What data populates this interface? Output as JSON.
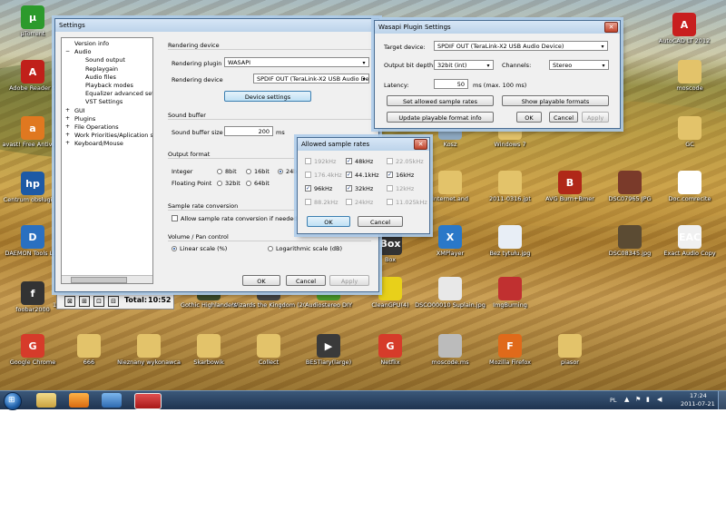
{
  "desktop_icons": [
    {
      "label": "µTorrent",
      "glyph": "µ",
      "color": "#2c9a2c"
    },
    {
      "label": "Adobe Reader 9",
      "glyph": "A",
      "color": "#c0201a"
    },
    {
      "label": "avast! Free Antivirus",
      "glyph": "a",
      "color": "#e07820"
    },
    {
      "label": "Centrum obsługi HP",
      "glyph": "hp",
      "color": "#1d5aa5"
    },
    {
      "label": "DAEMON Tools Lite",
      "glyph": "D",
      "color": "#2a70c0"
    },
    {
      "label": "foobar2000",
      "glyph": "f",
      "color": "#333333"
    },
    {
      "label": "Google Chrome",
      "glyph": "G",
      "color": "#d63b2a"
    },
    {
      "label": "666",
      "glyph": "",
      "color": "#e3c36a"
    },
    {
      "label": "Nieznany wykonawca",
      "glyph": "",
      "color": "#e3c36a"
    },
    {
      "label": "Skarbowik",
      "glyph": "",
      "color": "#e3c36a"
    },
    {
      "label": "Collect",
      "glyph": "",
      "color": "#e3c36a"
    },
    {
      "label": "BESTiary(large)",
      "glyph": "▶",
      "color": "#3a3a3a"
    },
    {
      "label": "Netflix",
      "glyph": "G",
      "color": "#d63b2a"
    },
    {
      "label": "moscode.ms",
      "glyph": "",
      "color": "#bbbbbb"
    },
    {
      "label": "Mozilla Firefox",
      "glyph": "F",
      "color": "#e06a1a"
    },
    {
      "label": "piasor",
      "glyph": "",
      "color": "#e3c36a"
    },
    {
      "label": "AutoCAD LT 2012",
      "glyph": "A",
      "color": "#c81f1f"
    },
    {
      "label": "moscode",
      "glyph": "",
      "color": "#e3c36a"
    },
    {
      "label": "GC",
      "glyph": "",
      "color": "#e3c36a"
    },
    {
      "label": "Kosz",
      "glyph": "",
      "color": "#8ea9c2"
    },
    {
      "label": "Windows 7",
      "glyph": "",
      "color": "#e3c36a"
    },
    {
      "label": "Internet.and",
      "glyph": "",
      "color": "#e3c36a"
    },
    {
      "label": "2011-0316.jpt",
      "glyph": "",
      "color": "#e3c36a"
    },
    {
      "label": "AVG Burn+Bmer",
      "glyph": "B",
      "color": "#b02818"
    },
    {
      "label": "DSC07965.JPG",
      "glyph": "",
      "color": "#7a3a2a"
    },
    {
      "label": "Doc.comrecite",
      "glyph": "",
      "color": "#ffffff"
    },
    {
      "label": "XMPlayer",
      "glyph": "X",
      "color": "#2a78c8"
    },
    {
      "label": "Bez tytułu.jpg",
      "glyph": "",
      "color": "#e8eef6"
    },
    {
      "label": "DSC08345.jpg",
      "glyph": "",
      "color": "#5b4b33"
    },
    {
      "label": "Exact Audio Copy",
      "glyph": "EAC",
      "color": "#f0f0f0"
    },
    {
      "label": "CleanGPU(4)",
      "glyph": "",
      "color": "#e8d01a"
    },
    {
      "label": "DSCO00010 Suplain.jpg",
      "glyph": "",
      "color": "#e8e8e8"
    },
    {
      "label": "ImgBurning",
      "glyph": "",
      "color": "#c03030"
    },
    {
      "label": "Box",
      "glyph": "Box",
      "color": "#333333"
    },
    {
      "label": "Wizards the Kingdom (2002)",
      "glyph": "",
      "color": "#444444"
    },
    {
      "label": "Audiostereo DIY",
      "glyph": "",
      "color": "#4a9a2a"
    },
    {
      "label": "Gothic Highlanders",
      "glyph": "",
      "color": "#3a4a2a"
    },
    {
      "label": "muzyka",
      "glyph": "",
      "color": "#e3c36a"
    },
    {
      "label": "13. The Final Frontier (2010)",
      "glyph": "",
      "color": "#222222"
    }
  ],
  "foobar_strip": {
    "total_label": "Total:",
    "total_value": "10:52"
  },
  "settings_window": {
    "title": "Settings",
    "tree": [
      {
        "label": "Version info",
        "indent": 0
      },
      {
        "label": "Audio",
        "indent": 0
      },
      {
        "label": "Sound output",
        "indent": 1
      },
      {
        "label": "Replaygain",
        "indent": 1
      },
      {
        "label": "Audio files",
        "indent": 1
      },
      {
        "label": "Playback modes",
        "indent": 1
      },
      {
        "label": "Equalizer advanced settings",
        "indent": 1
      },
      {
        "label": "VST Settings",
        "indent": 1
      },
      {
        "label": "GUI",
        "indent": 0
      },
      {
        "label": "Plugins",
        "indent": 0
      },
      {
        "label": "File Operations",
        "indent": 0
      },
      {
        "label": "Work Priorities/Aplication settings",
        "indent": 0
      },
      {
        "label": "Keyboard/Mouse",
        "indent": 0
      }
    ],
    "rendering_device_header": "Rendering device",
    "rendering_plugin_label": "Rendering plugin",
    "rendering_plugin_value": "WASAPI",
    "rendering_device_label": "Rendering device",
    "rendering_device_value": "SPDIF OUT (TeraLink-X2 USB Audio Device)",
    "device_settings_label": "Device settings",
    "sound_buffer_header": "Sound buffer",
    "sound_buffer_label": "Sound buffer size",
    "sound_buffer_value": "200",
    "sound_buffer_unit": "ms",
    "output_format_header": "Output format",
    "integer_label": "Integer",
    "integer_8bit": "8bit",
    "integer_16bit": "16bit",
    "integer_24bit": "24bit",
    "floating_label": "Floating Point",
    "float_32bit": "32bit",
    "float_64bit": "64bit",
    "src_header": "Sample rate conversion",
    "src_checkbox_label": "Allow sample rate conversion if needed",
    "volume_header": "Volume / Pan control",
    "linear_label": "Linear scale (%)",
    "log_label": "Logarithmic scale (dB)",
    "ok": "OK",
    "cancel": "Cancel",
    "apply": "Apply"
  },
  "wasapi_window": {
    "title": "Wasapi Plugin Settings",
    "target_label": "Target device:",
    "target_value": "SPDIF OUT (TeraLink-X2 USB Audio Device)",
    "depth_label": "Output bit depth:",
    "depth_value": "32bit (int)",
    "channels_label": "Channels:",
    "channels_value": "Stereo",
    "latency_label": "Latency:",
    "latency_value": "50",
    "latency_unit": "ms  (max. 100 ms)",
    "set_rates_label": "Set allowed sample rates",
    "show_formats_label": "Show playable formats",
    "update_info_label": "Update playable format info",
    "ok": "OK",
    "cancel": "Cancel",
    "apply": "Apply"
  },
  "sample_rates_dialog": {
    "title": "Allowed sample rates",
    "rates": [
      {
        "label": "192kHz",
        "checked": false,
        "enabled": false
      },
      {
        "label": "48kHz",
        "checked": true,
        "enabled": true
      },
      {
        "label": "22.05kHz",
        "checked": false,
        "enabled": false
      },
      {
        "label": "176.4kHz",
        "checked": false,
        "enabled": false
      },
      {
        "label": "44.1kHz",
        "checked": true,
        "enabled": true
      },
      {
        "label": "16kHz",
        "checked": true,
        "enabled": true
      },
      {
        "label": "96kHz",
        "checked": true,
        "enabled": true
      },
      {
        "label": "32kHz",
        "checked": true,
        "enabled": true
      },
      {
        "label": "12kHz",
        "checked": false,
        "enabled": false
      },
      {
        "label": "88.2kHz",
        "checked": false,
        "enabled": false
      },
      {
        "label": "24kHz",
        "checked": false,
        "enabled": false
      },
      {
        "label": "11.025kHz",
        "checked": false,
        "enabled": false
      }
    ],
    "ok": "OK",
    "cancel": "Cancel"
  },
  "taskbar": {
    "language": "PL",
    "time": "17:24",
    "date": "2011-07-21"
  }
}
